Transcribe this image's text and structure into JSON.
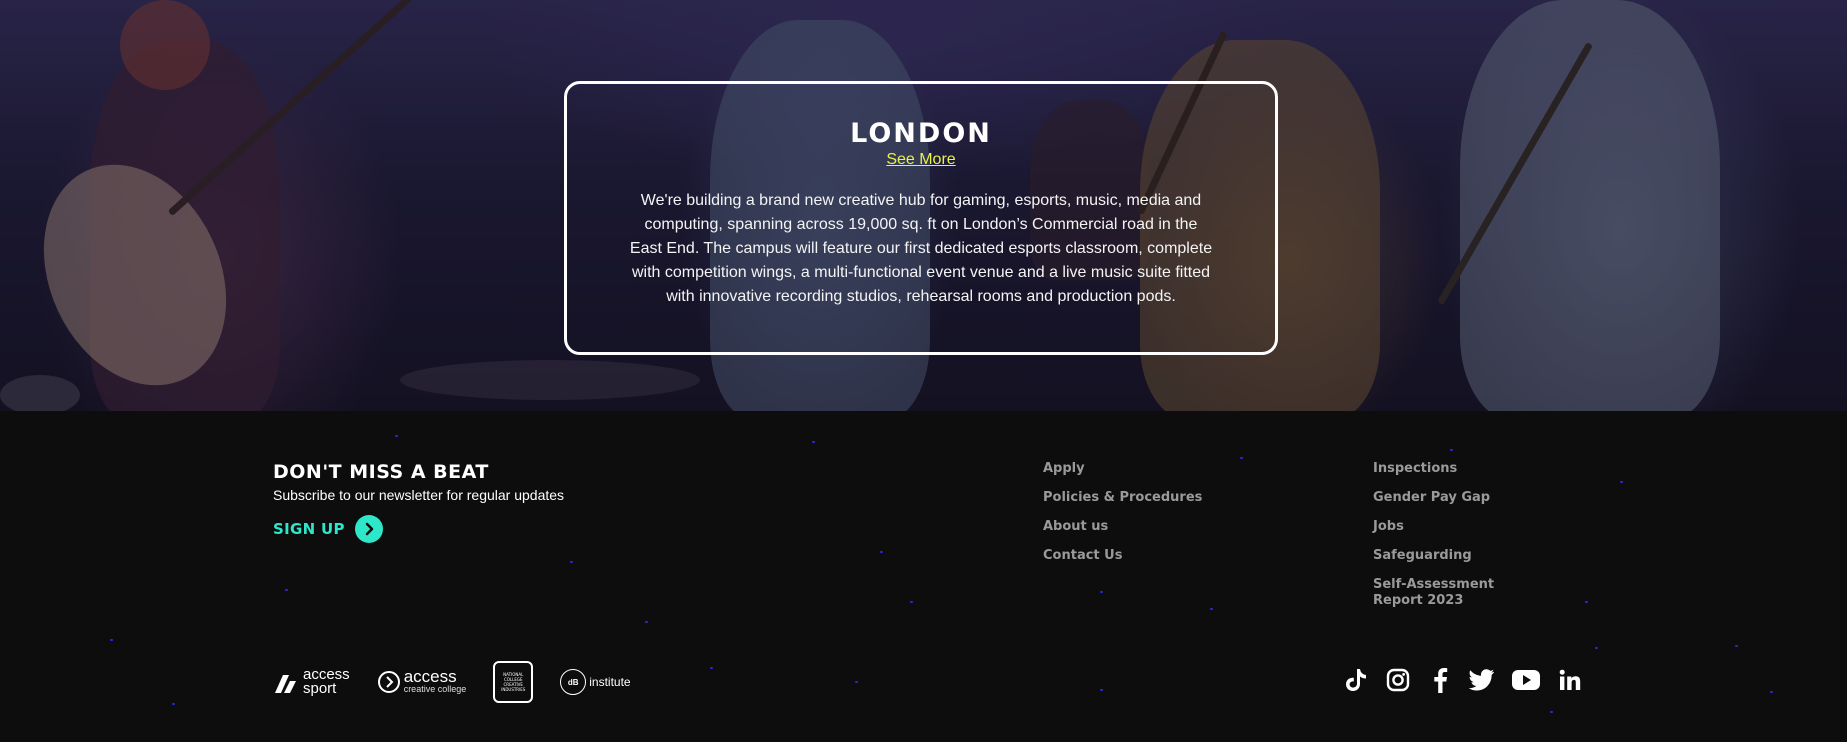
{
  "hero": {
    "title": "LONDON",
    "link_label": "See More",
    "description": "We're building a brand new creative hub for gaming, esports, music, media and computing, spanning across 19,000 sq. ft on London’s Commercial road in the East End. The campus will feature our first dedicated esports classroom, complete with competition wings, a multi-functional event venue and a live music suite fitted with innovative recording studios, rehearsal rooms and production pods."
  },
  "newsletter": {
    "title": "DON'T MISS A BEAT",
    "subtitle": "Subscribe to our newsletter for regular updates",
    "signup_label": "SIGN UP"
  },
  "links": {
    "col1": [
      "Apply",
      "Policies & Procedures",
      "About us",
      "Contact Us"
    ],
    "col2": [
      "Inspections",
      "Gender Pay Gap",
      "Jobs",
      "Safeguarding",
      "Self-Assessment Report 2023"
    ]
  },
  "logos": {
    "access_sport": {
      "line1": "access",
      "line2": "sport"
    },
    "access_creative": {
      "line1": "access",
      "line2": "creative college"
    },
    "ncco": {
      "text": "NATIONAL COLLEGE CREATIVE INDUSTRIES"
    },
    "dbs": {
      "mark": "dB",
      "text": "institute"
    }
  },
  "socials": [
    "tiktok-icon",
    "instagram-icon",
    "facebook-icon",
    "twitter-icon",
    "youtube-icon",
    "linkedin-icon"
  ],
  "colors": {
    "accent": "#2ee6c8",
    "link": "#e8f24a",
    "footer_bg": "#0d0d0d",
    "footer_link": "#9a9a9a"
  }
}
